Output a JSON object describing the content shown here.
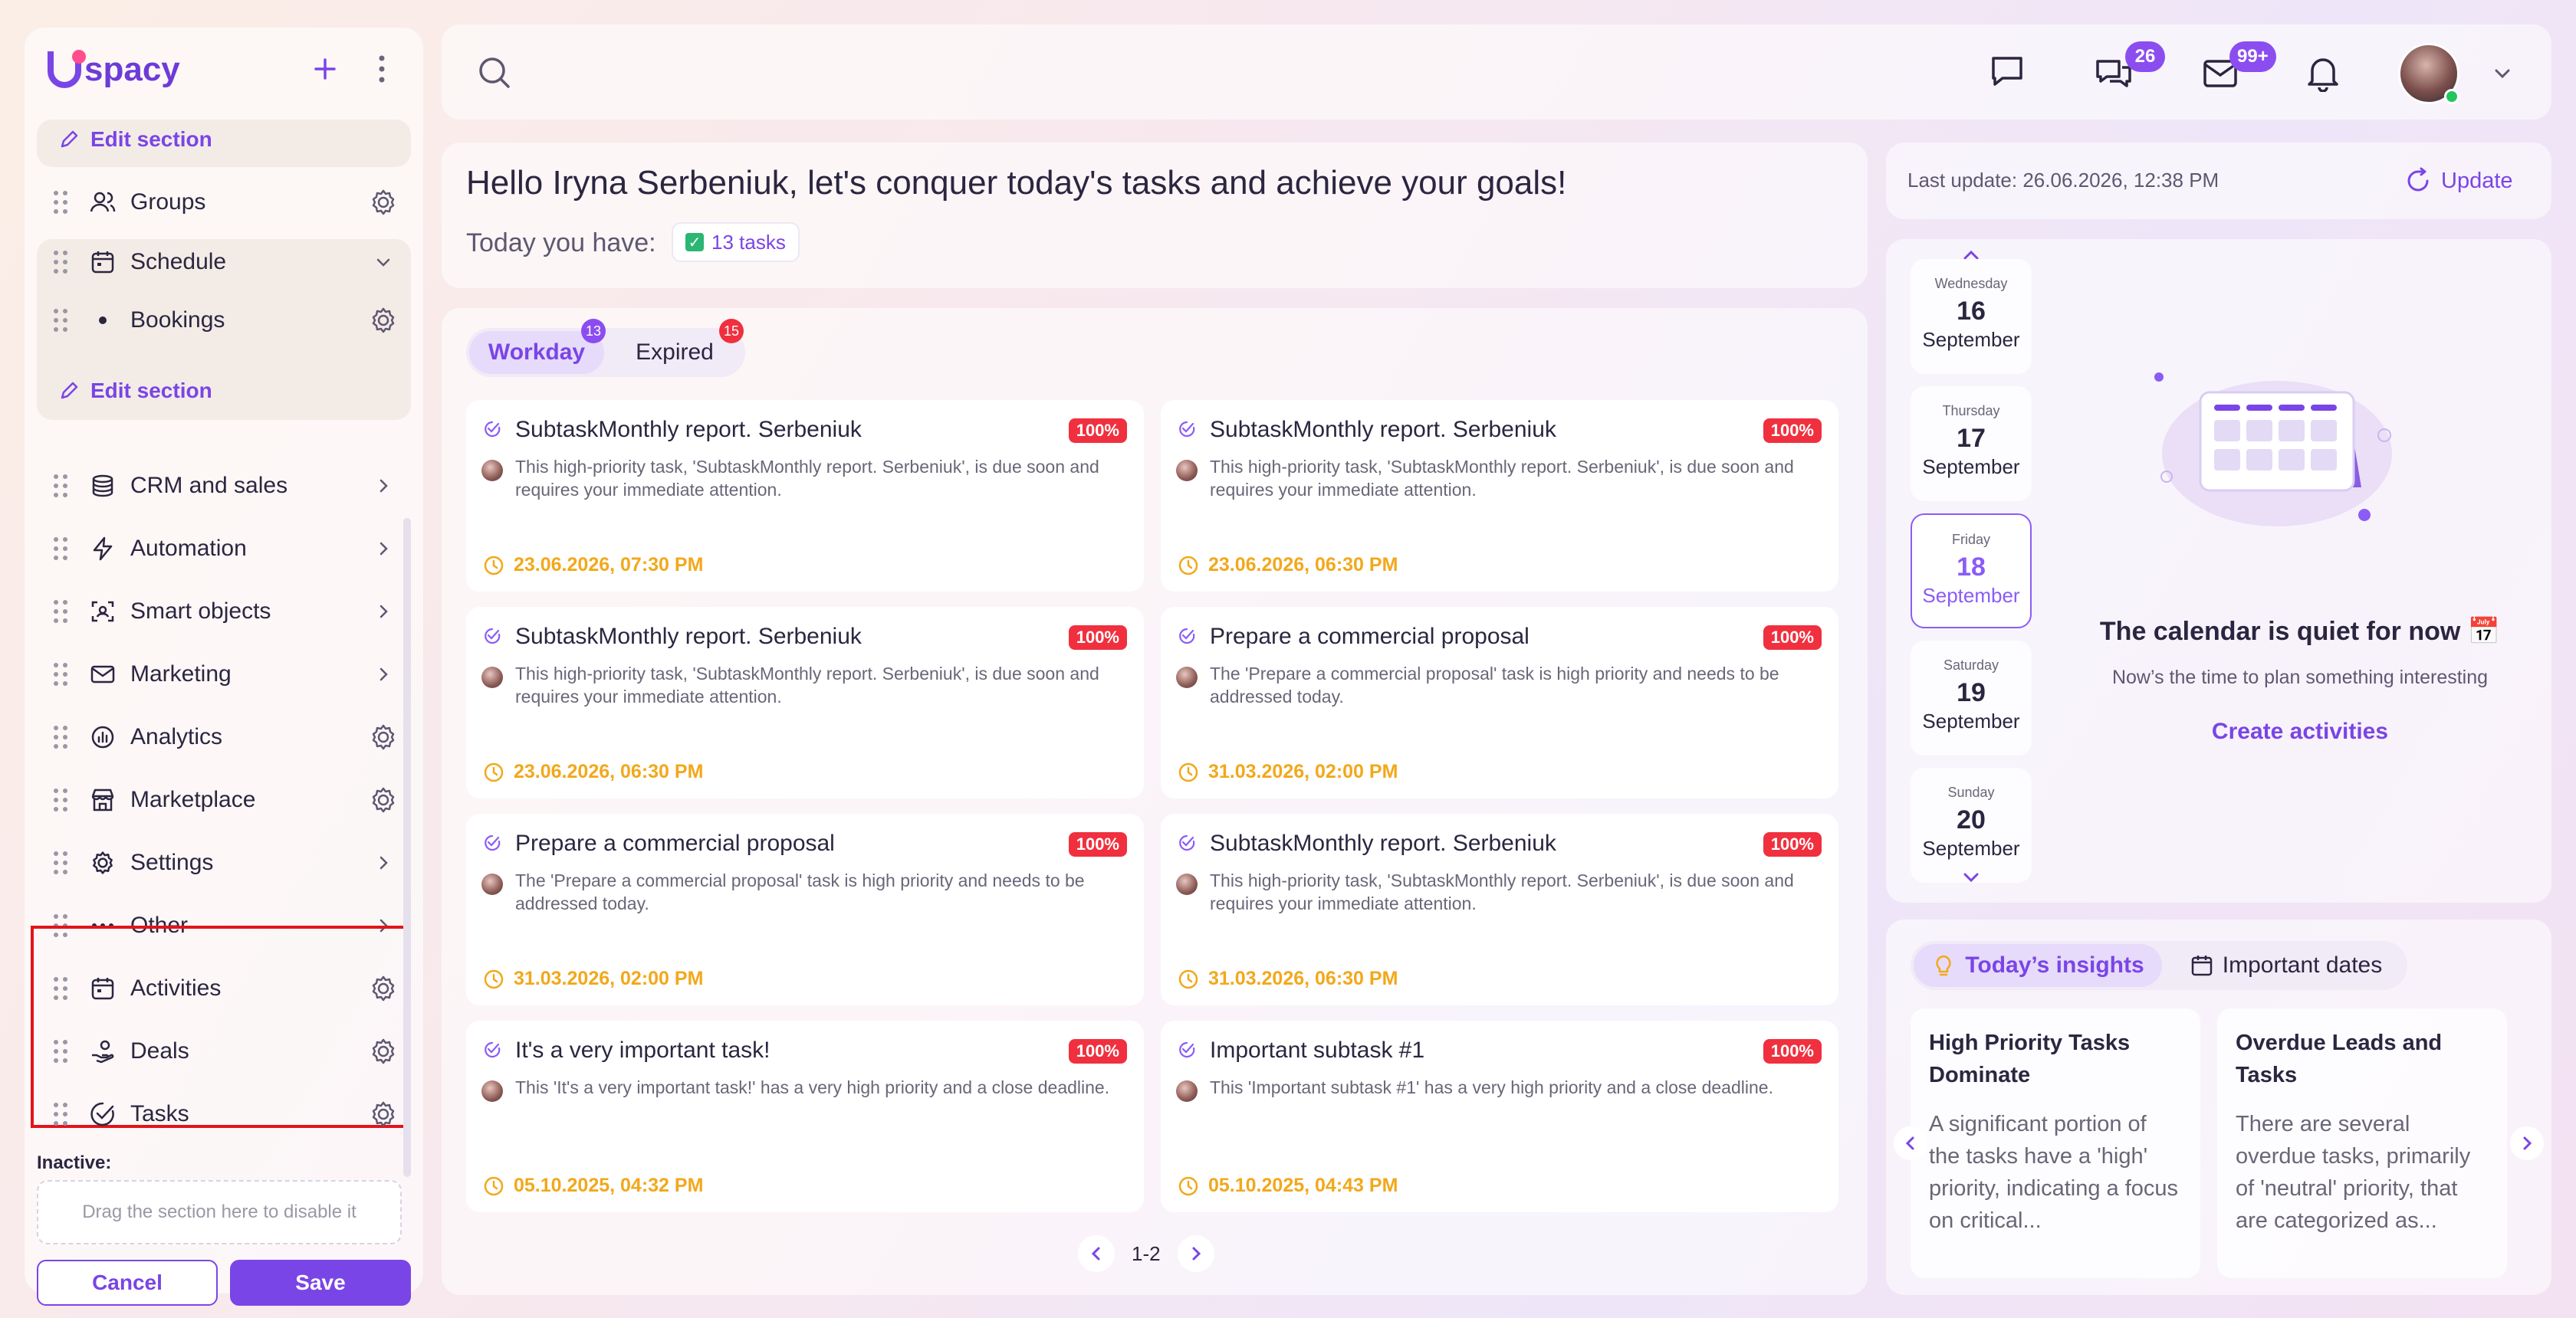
{
  "brand": {
    "logo_text": "spacy",
    "accent": "#7a45e6"
  },
  "sidebar": {
    "edit_section_top": "Edit section",
    "groups": "Groups",
    "schedule": "Schedule",
    "bookings": "Bookings",
    "edit_section": "Edit section",
    "items": [
      {
        "label": "CRM and sales",
        "icon": "crm-icon",
        "action": "chevron"
      },
      {
        "label": "Automation",
        "icon": "bolt-icon",
        "action": "chevron"
      },
      {
        "label": "Smart objects",
        "icon": "smart-objects-icon",
        "action": "chevron"
      },
      {
        "label": "Marketing",
        "icon": "envelope-icon",
        "action": "chevron"
      },
      {
        "label": "Analytics",
        "icon": "analytics-icon",
        "action": "gear"
      },
      {
        "label": "Marketplace",
        "icon": "store-icon",
        "action": "gear"
      },
      {
        "label": "Settings",
        "icon": "gear-icon",
        "action": "chevron"
      },
      {
        "label": "Other",
        "icon": "more-icon",
        "action": "chevron"
      }
    ],
    "highlighted": [
      {
        "label": "Activities",
        "icon": "calendar-icon"
      },
      {
        "label": "Deals",
        "icon": "deals-icon"
      },
      {
        "label": "Tasks",
        "icon": "check-circle-icon"
      }
    ],
    "inactive_label": "Inactive:",
    "dropzone": "Drag the section here to disable it",
    "cancel": "Cancel",
    "save": "Save"
  },
  "topbar": {
    "chat_badge": "26",
    "mail_badge": "99+"
  },
  "hello": {
    "title": "Hello Iryna Serbeniuk, let's conquer today's tasks and achieve your goals!",
    "today_label": "Today you have:",
    "task_count": "13 tasks"
  },
  "tasks": {
    "tabs": [
      {
        "label": "Workday",
        "badge": "13"
      },
      {
        "label": "Expired",
        "badge": "15"
      }
    ],
    "cards": [
      {
        "title": "SubtaskMonthly report. Serbeniuk",
        "pct": "100%",
        "desc": "This high-priority task, 'SubtaskMonthly report. Serbeniuk', is due soon and requires your immediate attention.",
        "due": "23.06.2026, 07:30 PM"
      },
      {
        "title": "SubtaskMonthly report. Serbeniuk",
        "pct": "100%",
        "desc": "This high-priority task, 'SubtaskMonthly report. Serbeniuk', is due soon and requires your immediate attention.",
        "due": "23.06.2026, 06:30 PM"
      },
      {
        "title": "SubtaskMonthly report. Serbeniuk",
        "pct": "100%",
        "desc": "This high-priority task, 'SubtaskMonthly report. Serbeniuk', is due soon and requires your immediate attention.",
        "due": "23.06.2026, 06:30 PM"
      },
      {
        "title": "Prepare a commercial proposal",
        "pct": "100%",
        "desc": "The 'Prepare a commercial proposal' task is high priority and needs to be addressed today.",
        "due": "31.03.2026, 02:00 PM"
      },
      {
        "title": "Prepare a commercial proposal",
        "pct": "100%",
        "desc": "The 'Prepare a commercial proposal' task is high priority and needs to be addressed today.",
        "due": "31.03.2026, 02:00 PM"
      },
      {
        "title": "SubtaskMonthly report. Serbeniuk",
        "pct": "100%",
        "desc": "This high-priority task, 'SubtaskMonthly report. Serbeniuk', is due soon and requires your immediate attention.",
        "due": "31.03.2026, 06:30 PM"
      },
      {
        "title": "It's a very important task!",
        "pct": "100%",
        "desc": "This 'It's a very important task!' has a very high priority and a close deadline.",
        "due": "05.10.2025, 04:32 PM"
      },
      {
        "title": "Important subtask #1",
        "pct": "100%",
        "desc": "This 'Important subtask #1' has a very high priority and a close deadline.",
        "due": "05.10.2025, 04:43 PM"
      }
    ],
    "pager": "1-2"
  },
  "last_update": {
    "text": "Last update: 26.06.2026, 12:38 PM",
    "button": "Update"
  },
  "calendar": {
    "days": [
      {
        "weekday": "Wednesday",
        "day": "16",
        "month": "September"
      },
      {
        "weekday": "Thursday",
        "day": "17",
        "month": "September"
      },
      {
        "weekday": "Friday",
        "day": "18",
        "month": "September",
        "selected": true
      },
      {
        "weekday": "Saturday",
        "day": "19",
        "month": "September"
      },
      {
        "weekday": "Sunday",
        "day": "20",
        "month": "September"
      }
    ],
    "empty_title": "The calendar is quiet for now 📅",
    "empty_sub": "Now’s the time to plan something interesting",
    "create": "Create activities"
  },
  "insights": {
    "tab_active": "Today’s insights",
    "tab_other": "Important dates",
    "cards": [
      {
        "title": "High Priority Tasks Dominate",
        "body": "A significant portion of the tasks have a 'high' priority, indicating a focus on critical..."
      },
      {
        "title": "Overdue Leads and Tasks",
        "body": "There are several overdue tasks, primarily of 'neutral' priority, that are categorized as..."
      }
    ]
  }
}
